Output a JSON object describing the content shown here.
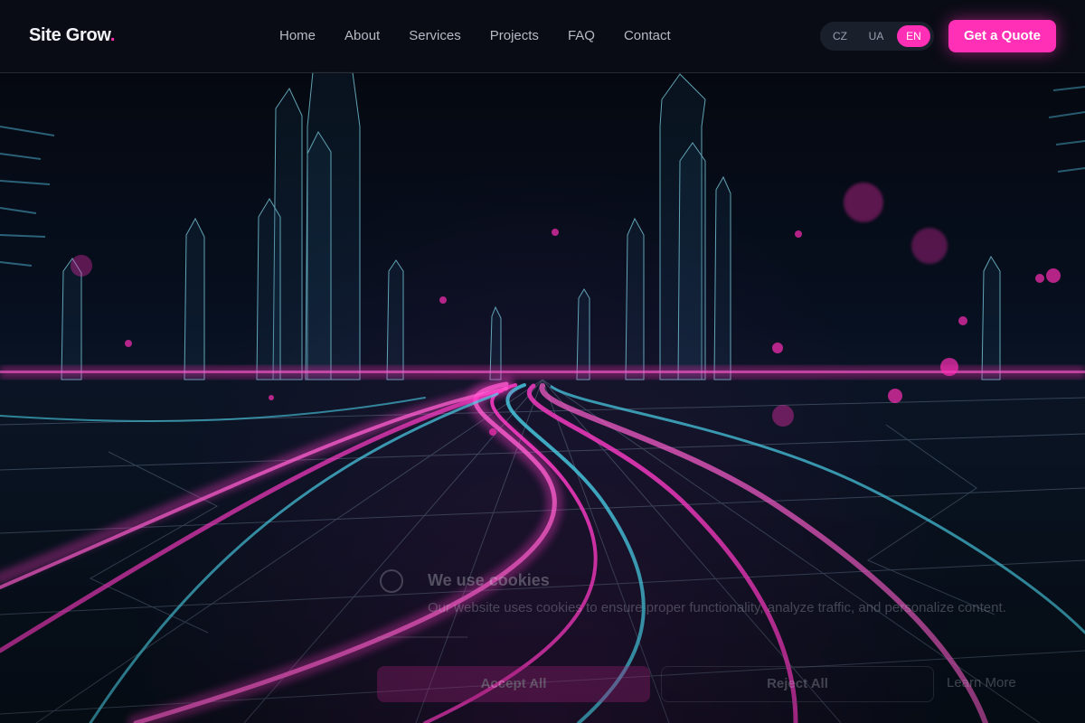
{
  "header": {
    "logo_text": "Site Grow",
    "logo_dot": ".",
    "nav": [
      "Home",
      "About",
      "Services",
      "Projects",
      "FAQ",
      "Contact"
    ],
    "languages": [
      "CZ",
      "UA",
      "EN"
    ],
    "active_language": "EN",
    "cta_label": "Get a Quote"
  },
  "cookie_banner": {
    "title": "We use cookies",
    "text": "Our website uses cookies to ensure proper functionality, analyze traffic, and personalize content.",
    "accept_label": "Accept All",
    "reject_label": "Reject All",
    "learn_more_label": "Learn More"
  },
  "colors": {
    "accent": "#ff2fb6",
    "background": "#05070d",
    "neon_cyan": "#3fd6e6",
    "neon_magenta": "#ff2fb6"
  }
}
